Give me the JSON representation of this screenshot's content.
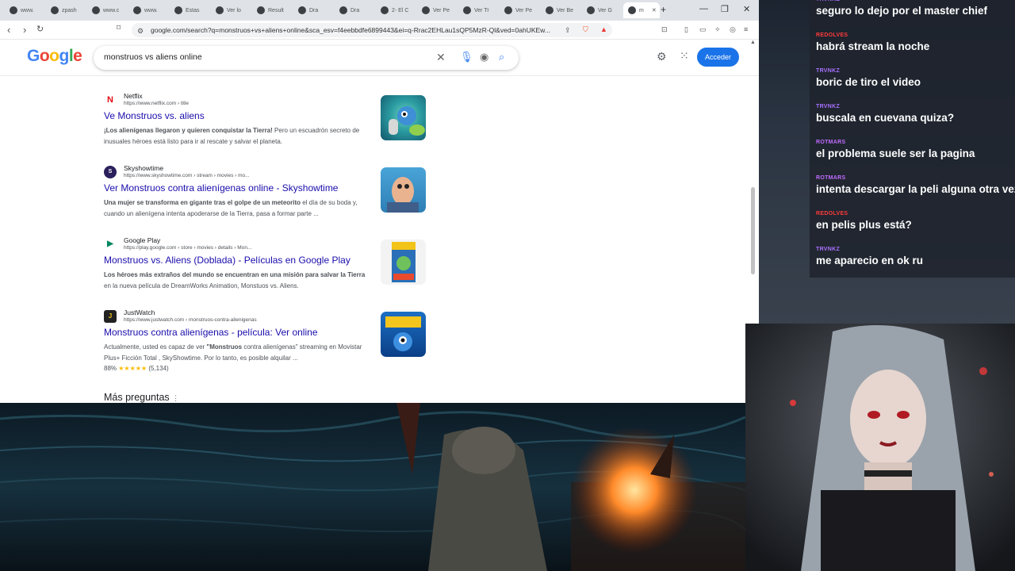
{
  "tabs": [
    {
      "label": "www.",
      "icon": "site"
    },
    {
      "label": "zpash",
      "icon": "site"
    },
    {
      "label": "www.c",
      "icon": "site"
    },
    {
      "label": "www.",
      "icon": "site"
    },
    {
      "label": "Estas",
      "icon": "p"
    },
    {
      "label": "Ver lo",
      "icon": "a"
    },
    {
      "label": "Result",
      "icon": "a"
    },
    {
      "label": "Dra",
      "icon": "d"
    },
    {
      "label": "Dra",
      "icon": "d"
    },
    {
      "label": "2- El C",
      "icon": "doc"
    },
    {
      "label": "Ver Pe",
      "icon": "a"
    },
    {
      "label": "Ver Tr",
      "icon": "a"
    },
    {
      "label": "Ver Pe",
      "icon": "a"
    },
    {
      "label": "Ver Be",
      "icon": "a"
    },
    {
      "label": "Ver G",
      "icon": "p"
    },
    {
      "label": "m",
      "icon": "G",
      "active": true
    }
  ],
  "url": "google.com/search?q=monstruos+vs+aliens+online&sca_esv=f4eebbdfe6899443&ei=q-Rrac2EHLau1sQP5MzR-Ql&ved=0ahUKEw...",
  "google": {
    "logo": "Google",
    "query": "monstruos vs aliens online",
    "signin": "Acceder"
  },
  "results": [
    {
      "site": "Netflix",
      "url": "https://www.netflix.com › title",
      "fav": "N",
      "fav_color": "#e50914",
      "title": "Ve Monstruos vs. aliens",
      "snippet_bold": "¡Los alienígenas llegaron y quieren conquistar la Tierra!",
      "snippet": " Pero un escuadrón secreto de inusuales héroes está listo para ir al rescate y salvar el planeta."
    },
    {
      "site": "Skyshowtime",
      "url": "https://www.skyshowtime.com › stream › movies › mo...",
      "fav": "S",
      "fav_color": "#3a2a6a",
      "title": "Ver Monstruos contra alienígenas online - Skyshowtime",
      "snippet_bold": "Una mujer se transforma en gigante tras el golpe de un meteorito",
      "snippet": " el día de su boda y, cuando un alienígena intenta apoderarse de la Tierra, pasa a formar parte ..."
    },
    {
      "site": "Google Play",
      "url": "https://play.google.com › store › movies › details › Mon...",
      "fav": "▶",
      "fav_color": "#01875f",
      "title": "Monstruos vs. Aliens (Doblada) - Películas en Google Play",
      "snippet_bold": "Los héroes más extraños del mundo se encuentran en una misión para salvar la Tierra",
      "snippet": " en la nueva película de DreamWorks Animation, Monstuos vs. Aliens."
    },
    {
      "site": "JustWatch",
      "url": "https://www.justwatch.com › monstruos-contra-alienigenas",
      "fav": "J",
      "fav_color": "#222",
      "title": "Monstruos contra alienígenas - película: Ver online",
      "snippet_pre": "Actualmente, usted es capaz de ver ",
      "snippet_bold": "\"Monstruos",
      "snippet": " contra alienígenas\" streaming en Movistar Plus+ Ficción Total , SkyShowtime. Por lo tanto, es posible alquilar ...",
      "rating_text": "88%",
      "stars": "★★★★★",
      "rating_count": "(5,134)"
    }
  ],
  "more_questions": "Más preguntas",
  "chat": [
    {
      "user": "TRVNKZ",
      "color": "#a970ff",
      "text": "seguro lo dejo por el master chief"
    },
    {
      "user": "REDOLVES",
      "color": "#ff3b3b",
      "text": "habrá stream la noche"
    },
    {
      "user": "TRVNKZ",
      "color": "#a970ff",
      "text": "boric de tiro el video"
    },
    {
      "user": "TRVNKZ",
      "color": "#a970ff",
      "text": "buscala en cuevana quiza?"
    },
    {
      "user": "ROTMARS",
      "color": "#c06bff",
      "text": "el problema suele ser la pagina"
    },
    {
      "user": "ROTMARS",
      "color": "#c06bff",
      "text": "intenta descargar la peli alguna otra vez"
    },
    {
      "user": "REDOLVES",
      "color": "#ff3b3b",
      "text": "en pelis plus está?"
    },
    {
      "user": "TRVNKZ",
      "color": "#a970ff",
      "text": "me aparecio en ok ru"
    }
  ]
}
